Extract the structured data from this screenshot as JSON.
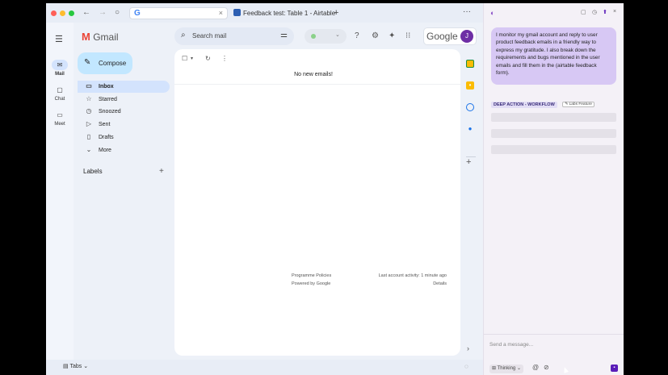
{
  "browser": {
    "tab_active_glyph": "G",
    "tab_close": "×",
    "tab2_title": "Feedback test: Table 1 - Airtable",
    "new_tab": "+",
    "more": "···",
    "back": "←",
    "forward": "→",
    "reload": "○"
  },
  "gmail": {
    "app_name": "Gmail",
    "logo_letter": "M",
    "search_placeholder": "Search mail",
    "compose_label": "Compose",
    "rail": [
      {
        "label": "Mail"
      },
      {
        "label": "Chat"
      },
      {
        "label": "Meet"
      }
    ],
    "nav": [
      {
        "label": "Inbox",
        "icon": "inbox-icon",
        "glyph": "▭",
        "active": true
      },
      {
        "label": "Starred",
        "icon": "star-icon",
        "glyph": "☆",
        "active": false
      },
      {
        "label": "Snoozed",
        "icon": "clock-icon",
        "glyph": "◷",
        "active": false
      },
      {
        "label": "Sent",
        "icon": "send-icon",
        "glyph": "▷",
        "active": false
      },
      {
        "label": "Drafts",
        "icon": "draft-icon",
        "glyph": "▯",
        "active": false
      },
      {
        "label": "More",
        "icon": "chevron-down-icon",
        "glyph": "⌄",
        "active": false
      }
    ],
    "labels_heading": "Labels",
    "labels_add": "+",
    "google_wordmark": "Google",
    "avatar_initial": "J",
    "empty_message": "No new emails!",
    "footer": {
      "programme_policies": "Programme Policies",
      "powered_by": "Powered by Google",
      "last_activity": "Last account activity: 1 minute ago",
      "details": "Details"
    }
  },
  "bottombar": {
    "tabs_label": "Tabs"
  },
  "panel": {
    "user_message": "I monitor my gmail account and reply to user product feedback emails in a friendly way to express my gratitude. I also break down the requirements and bugs mentioned in the user emails and fill them in the (airtable feedback form).",
    "workflow_tag": "DEEP ACTION - WORKFLOW",
    "labs_tag": "Labs Feature",
    "message_placeholder": "Send a message...",
    "mode_label": "Thinking"
  },
  "colors": {
    "accent_purple": "#5a1db8",
    "bubble": "#d7c8f4",
    "compose": "#c2e7ff",
    "active_nav": "#d3e3fd"
  }
}
